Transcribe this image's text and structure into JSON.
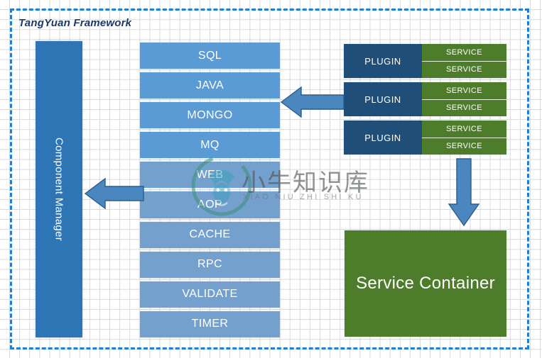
{
  "diagram": {
    "title": "TangYuan Framework",
    "component_manager": {
      "label": "Component Manager"
    },
    "components": [
      {
        "label": "SQL"
      },
      {
        "label": "JAVA"
      },
      {
        "label": "MONGO"
      },
      {
        "label": "MQ"
      },
      {
        "label": "WEB"
      },
      {
        "label": "AOP"
      },
      {
        "label": "CACHE"
      },
      {
        "label": "RPC"
      },
      {
        "label": "VALIDATE"
      },
      {
        "label": "TIMER"
      }
    ],
    "plugins": [
      {
        "label": "PLUGIN",
        "services": [
          {
            "label": "SERVICE"
          },
          {
            "label": "SERVICE"
          }
        ]
      },
      {
        "label": "PLUGIN",
        "services": [
          {
            "label": "SERVICE"
          },
          {
            "label": "SERVICE"
          }
        ]
      },
      {
        "label": "PLUGIN",
        "services": [
          {
            "label": "SERVICE"
          },
          {
            "label": "SERVICE"
          }
        ]
      }
    ],
    "service_container": {
      "label": "Service Container"
    },
    "arrows": [
      {
        "name": "plugins-to-components",
        "direction": "left"
      },
      {
        "name": "components-to-component-manager",
        "direction": "left"
      },
      {
        "name": "plugins-to-service-container",
        "direction": "down"
      }
    ],
    "colors": {
      "frame_dashed": "#1f7fd4",
      "title_text": "#1f3864",
      "component_manager": "#2e75b6",
      "component_block": "#5b9bd5",
      "component_block_muted": "#74a0cd",
      "plugin": "#1f4e79",
      "service": "#4d7c2a",
      "service_container": "#4d7c2a",
      "arrow_fill": "#4a87be",
      "arrow_stroke": "#2b5d8a",
      "grid_line": "#d9d9d9",
      "background": "#ffffff"
    }
  },
  "watermark": {
    "chinese": "小牛知识库",
    "pinyin": "XIAO NIU ZHI SHI KU",
    "logo": "bull-circle-logo"
  }
}
